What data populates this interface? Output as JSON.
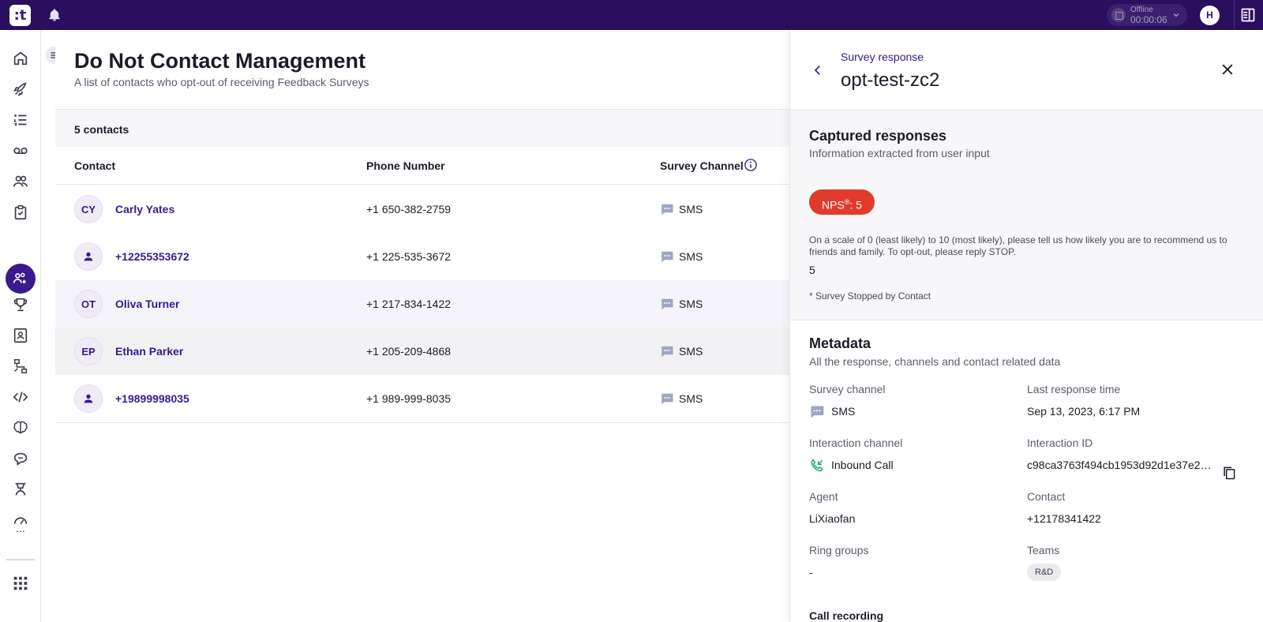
{
  "topbar": {
    "logo_text": ":t",
    "status_label": "Offline",
    "status_time": "00:00:06",
    "user_initial": "H"
  },
  "sidebar": {
    "more_label": "...",
    "icons": [
      "home-icon",
      "rocket-icon",
      "list-icon",
      "voicemail-icon",
      "users-icon",
      "clipboard-icon",
      "contacts-star-icon",
      "trophy-icon",
      "address-book-icon",
      "workflow-icon",
      "code-icon",
      "brain-icon",
      "chat-icon",
      "agent-icon",
      "speedometer-icon",
      "apps-grid-icon"
    ]
  },
  "page": {
    "title": "Do Not Contact Management",
    "subtitle": "A list of contacts who opt-out of receiving Feedback Surveys",
    "count": "5 contacts"
  },
  "table": {
    "headers": {
      "contact": "Contact",
      "phone": "Phone Number",
      "channel": "Survey Channel"
    },
    "rows": [
      {
        "initials": "CY",
        "name": "Carly Yates",
        "phone": "+1 650-382-2759",
        "channel": "SMS"
      },
      {
        "initials": "",
        "name": "+12255353672",
        "phone": "+1 225-535-3672",
        "channel": "SMS"
      },
      {
        "initials": "OT",
        "name": "Oliva Turner",
        "phone": "+1 217-834-1422",
        "channel": "SMS"
      },
      {
        "initials": "EP",
        "name": "Ethan Parker",
        "phone": "+1 205-209-4868",
        "channel": "SMS"
      },
      {
        "initials": "",
        "name": "+19899998035",
        "phone": "+1 989-999-8035",
        "channel": "SMS"
      }
    ]
  },
  "panel": {
    "kicker": "Survey response",
    "title": "opt-test-zc2",
    "captured": {
      "title": "Captured responses",
      "subtitle": "Information extracted from user input",
      "nps_label": "NPS",
      "nps_sup": "®",
      "nps_value": ": 5",
      "question": "On a scale of 0 (least likely) to 10 (most likely), please tell us how likely you are to recommend us to friends and family. To opt-out, please reply STOP.",
      "answer": "5",
      "note": "* Survey Stopped by Contact"
    },
    "metadata": {
      "title": "Metadata",
      "subtitle": "All the response, channels and contact related data",
      "survey_channel_label": "Survey channel",
      "survey_channel_value": "SMS",
      "last_response_label": "Last response time",
      "last_response_value": "Sep 13, 2023, 6:17 PM",
      "interaction_channel_label": "Interaction channel",
      "interaction_channel_value": "Inbound Call",
      "interaction_id_label": "Interaction ID",
      "interaction_id_value": "c98ca3763f494cb1953d92d1e37e2…",
      "agent_label": "Agent",
      "agent_value": "LiXiaofan",
      "contact_label": "Contact",
      "contact_value": "+12178341422",
      "ring_groups_label": "Ring groups",
      "ring_groups_value": "-",
      "teams_label": "Teams",
      "teams_value": "R&D",
      "call_recording_label": "Call recording"
    }
  },
  "colors": {
    "brand": "#2a0f5e",
    "accent": "#3a1a8c",
    "nps_badge": "#e23b2e",
    "inbound_call": "#1fa971"
  }
}
